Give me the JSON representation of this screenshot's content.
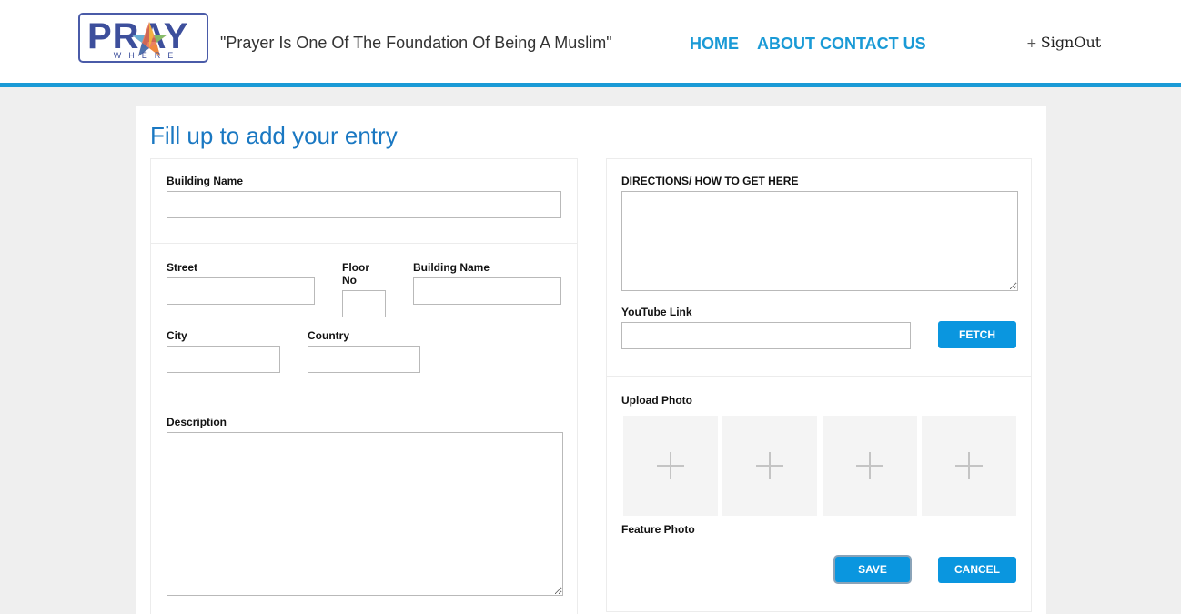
{
  "header": {
    "logo_text": "PRAY",
    "logo_subtext": "WHERE",
    "tagline": "\"Prayer Is One Of The Foundation Of Being A Muslim\"",
    "nav": {
      "home": "HOME",
      "about_contact": "ABOUT CONTACT US"
    },
    "signout_icon": "+",
    "signout": "SignOut",
    "accent_color": "#1a9ad6"
  },
  "form": {
    "title": "Fill up to add your entry",
    "left": {
      "building_name_label": "Building Name",
      "building_name_value": "",
      "street_label": "Street",
      "street_value": "",
      "floor_no_label_line1": "Floor",
      "floor_no_label_line2": "No",
      "floor_no_value": "",
      "building_name_2_label": "Building Name",
      "building_name_2_value": "",
      "city_label": "City",
      "city_value": "",
      "country_label": "Country",
      "country_value": "",
      "description_label": "Description",
      "description_value": ""
    },
    "right": {
      "directions_label": "DIRECTIONS/ HOW TO GET HERE",
      "directions_value": "",
      "youtube_label": "YouTube Link",
      "youtube_value": "",
      "fetch_button": "FETCH",
      "upload_photo_label": "Upload Photo",
      "photo_slot_icons": [
        "plus-icon",
        "plus-icon",
        "plus-icon",
        "plus-icon"
      ],
      "feature_photo_label": "Feature Photo",
      "save_button": "SAVE",
      "cancel_button": "CANCEL"
    }
  }
}
